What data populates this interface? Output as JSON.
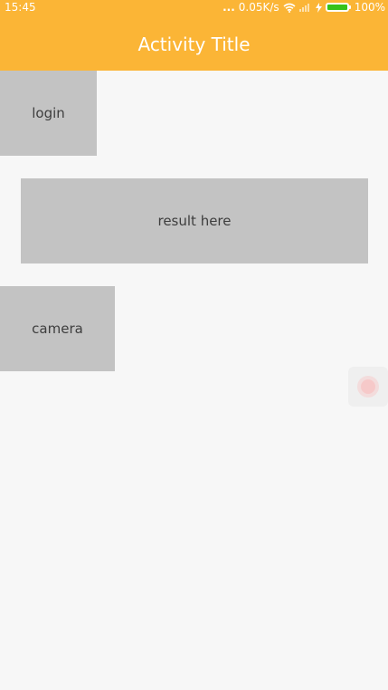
{
  "status_bar": {
    "time": "15:45",
    "dots": "...",
    "network_speed": "0.05K/s",
    "battery_percent": "100%",
    "battery_level": 1.0,
    "icons": [
      "wifi-icon",
      "signal-icon",
      "charging-bolt-icon",
      "battery-icon"
    ]
  },
  "app_bar": {
    "title": "Activity Title",
    "color": "#fbb536"
  },
  "main": {
    "login_label": "login",
    "result_text": "result here",
    "camera_label": "camera"
  },
  "colors": {
    "background": "#f7f7f7",
    "button": "#c3c3c3",
    "battery_fill": "#36c21a"
  }
}
